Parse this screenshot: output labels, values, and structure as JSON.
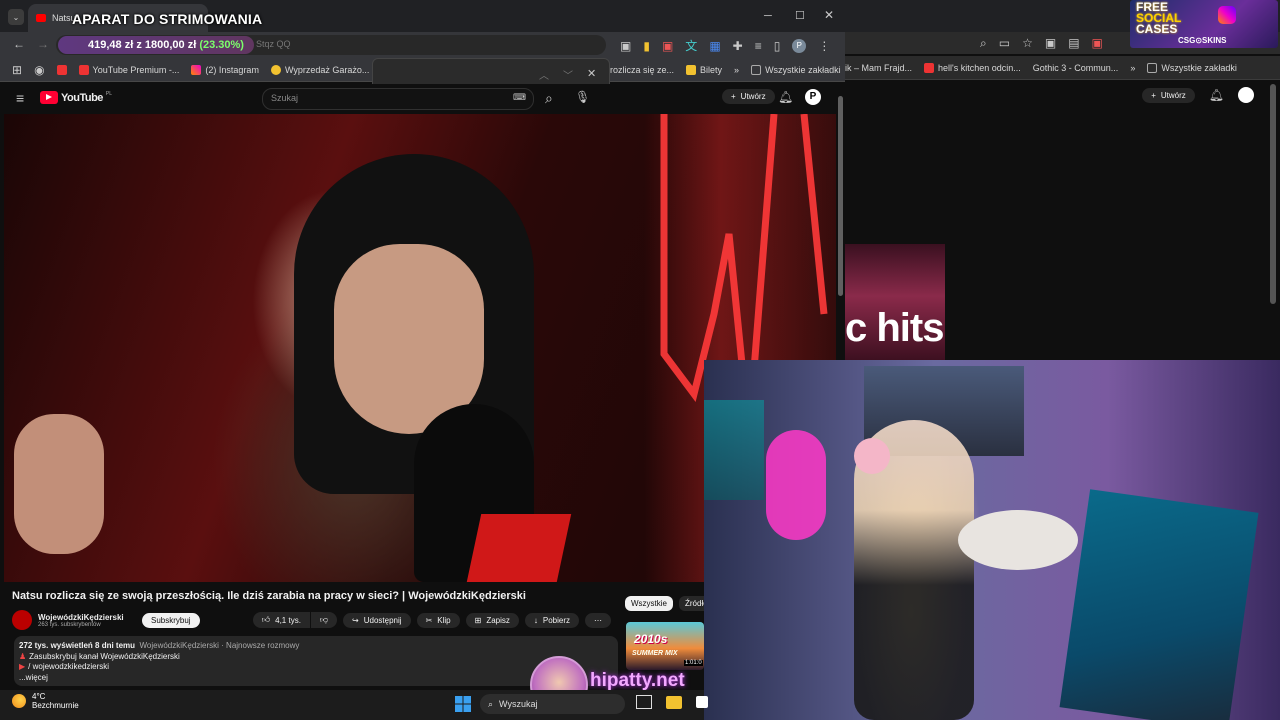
{
  "overlay": {
    "title": "APARAT DO STRIMOWANIA",
    "donation": "419,48 zł z 1800,00 zł (23.30%)",
    "donation_current": "419,48 zł",
    "donation_goal": "1800,00 zł",
    "donation_progress": 0.233,
    "url_fragment": "Stqz QQ",
    "streamer_handle": "hipatty.net"
  },
  "main_browser": {
    "tab_title": "Natsu",
    "bookmarks": [
      {
        "label": "YouTube Premium -..."
      },
      {
        "label": "(2) Instagram"
      },
      {
        "label": "Wyprzedaż Garażo..."
      },
      {
        "label": "V"
      },
      {
        "label": "rozlicza się ze..."
      },
      {
        "label": "Bilety"
      }
    ],
    "bookmarks_more": "»",
    "all_bookmarks": "Wszystkie zakładki"
  },
  "youtube": {
    "logo": "YouTube",
    "logo_country": "PL",
    "search_placeholder": "Szukaj",
    "create_label": "Utwórz",
    "avatar_letter": "P",
    "video_title": "Natsu rozlicza się ze swoją przeszłością. Ile dziś zarabia na pracy w sieci? | WojewódzkiKędzierski",
    "channel_name": "WojewódzkiKędzierski",
    "channel_subs": "263 tys. subskrybentów",
    "subscribe_label": "Subskrybuj",
    "likes": "4,1 tys.",
    "share_label": "Udostępnij",
    "clip_label": "Klip",
    "save_label": "Zapisz",
    "download_label": "Pobierz",
    "desc_meta": "272 tys. wyświetleń  8 dni temu",
    "desc_tags": "WojewódzkiKędzierski · Najnowsze rozmowy",
    "desc_line1": "Zasubskrybuj kanał WojewódzkiKędzierski",
    "desc_line2": "/ wojewodzkikedzierski",
    "desc_more": "...więcej",
    "chips": [
      "Wszystkie",
      "Źródło:"
    ],
    "side_thumb_text": "2010s",
    "side_thumb_sub": "SUMMER MIX",
    "side_thumb_time": "1:01:0"
  },
  "bg_browser": {
    "bookmarks": [
      {
        "label": "ik – Mam Frajd..."
      },
      {
        "label": "hell's kitchen odcin..."
      },
      {
        "label": "Gothic 3 - Commun..."
      }
    ],
    "all_bookmarks": "Wszystkie zakładki",
    "create_label": "Utwórz",
    "thumb_text": "c hits",
    "banner_line1": "FREE",
    "banner_line2": "SOCIAL",
    "banner_line3": "CASES",
    "banner_brand": "CSG⊙SKINS"
  },
  "taskbar": {
    "temperature": "4°C",
    "weather": "Bezchmurnie",
    "search_placeholder": "Wyszukaj"
  },
  "colors": {
    "yt_red": "#ff0033",
    "accent_blue": "#8ab4f8",
    "donation_green": "#7cff6b",
    "neon_pink": "#f2a8ff"
  }
}
